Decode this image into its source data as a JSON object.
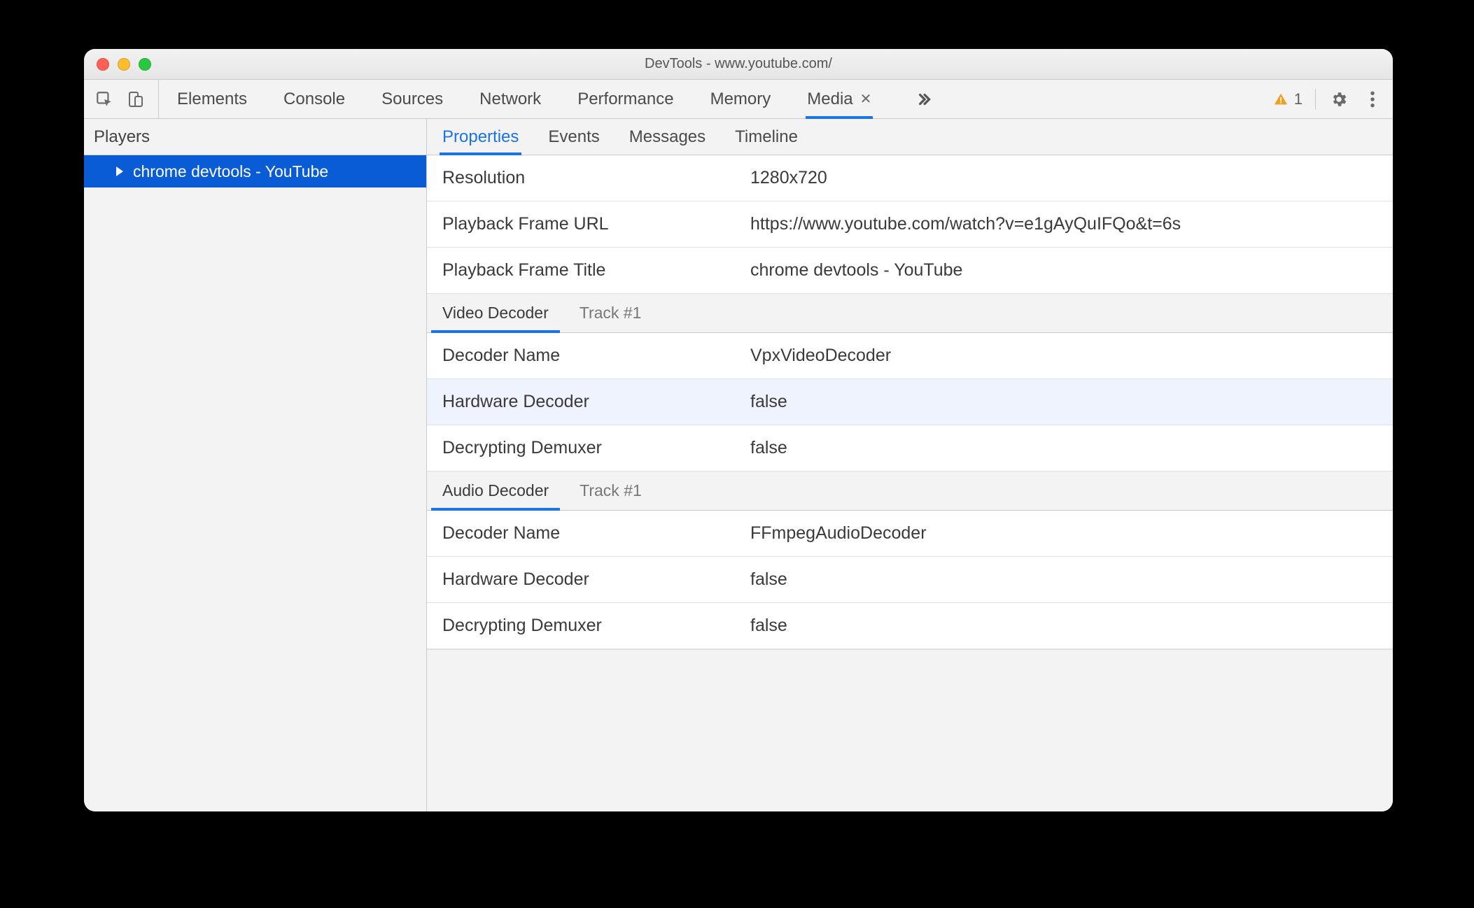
{
  "window": {
    "title": "DevTools - www.youtube.com/"
  },
  "toolbar": {
    "tabs": {
      "elements": "Elements",
      "console": "Console",
      "sources": "Sources",
      "network": "Network",
      "performance": "Performance",
      "memory": "Memory",
      "media": "Media"
    },
    "active_tab": "media",
    "warning_count": "1"
  },
  "players": {
    "header": "Players",
    "items": [
      {
        "label": "chrome devtools - YouTube"
      }
    ]
  },
  "subtabs": {
    "properties": "Properties",
    "events": "Events",
    "messages": "Messages",
    "timeline": "Timeline",
    "active": "properties"
  },
  "properties": {
    "top": [
      {
        "label": "Resolution",
        "value": "1280x720"
      },
      {
        "label": "Playback Frame URL",
        "value": "https://www.youtube.com/watch?v=e1gAyQuIFQo&t=6s"
      },
      {
        "label": "Playback Frame Title",
        "value": "chrome devtools - YouTube"
      }
    ],
    "video_section": {
      "title": "Video Decoder",
      "track": "Track #1",
      "rows": [
        {
          "label": "Decoder Name",
          "value": "VpxVideoDecoder"
        },
        {
          "label": "Hardware Decoder",
          "value": "false",
          "alt": true
        },
        {
          "label": "Decrypting Demuxer",
          "value": "false"
        }
      ]
    },
    "audio_section": {
      "title": "Audio Decoder",
      "track": "Track #1",
      "rows": [
        {
          "label": "Decoder Name",
          "value": "FFmpegAudioDecoder"
        },
        {
          "label": "Hardware Decoder",
          "value": "false"
        },
        {
          "label": "Decrypting Demuxer",
          "value": "false"
        }
      ]
    }
  }
}
